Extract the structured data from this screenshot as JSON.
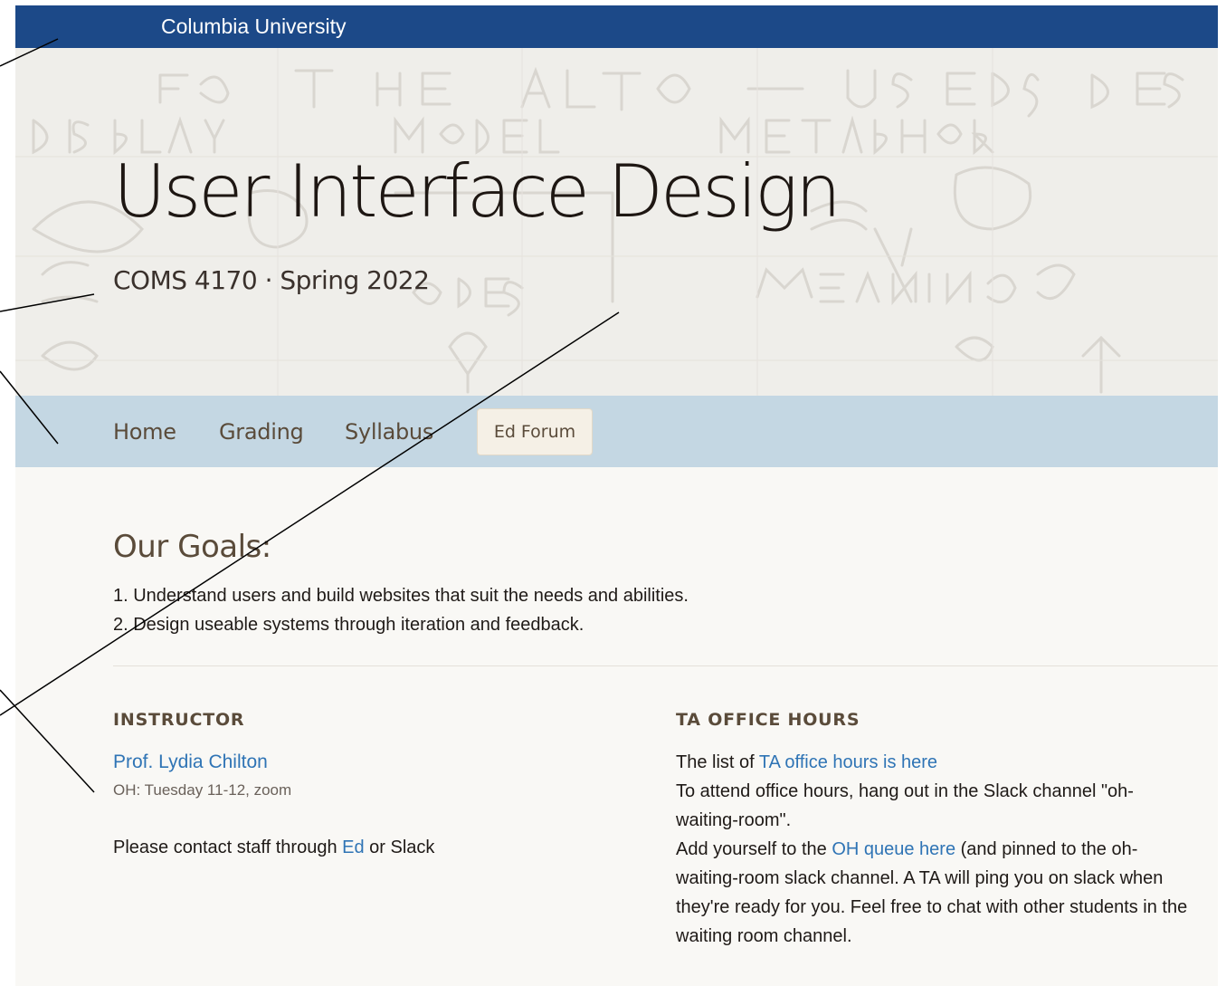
{
  "topbar": {
    "title": "Columbia University"
  },
  "hero": {
    "title": "User Interface Design",
    "subtitle": "COMS 4170 · Spring 2022"
  },
  "nav": {
    "items": [
      {
        "label": "Home"
      },
      {
        "label": "Grading"
      },
      {
        "label": "Syllabus"
      }
    ],
    "button_label": "Ed Forum"
  },
  "goals": {
    "heading": "Our Goals:",
    "items": [
      "1. Understand users and build websites that suit the needs and abilities.",
      "2. Design useable systems through iteration and feedback."
    ]
  },
  "instructor": {
    "heading": "INSTRUCTOR",
    "name": "Prof. Lydia Chilton",
    "office_hours": "OH: Tuesday 11-12, zoom",
    "contact_prefix": "Please contact staff through ",
    "contact_link": "Ed",
    "contact_suffix": " or Slack"
  },
  "ta": {
    "heading": "TA OFFICE HOURS",
    "line1_prefix": "The list of ",
    "line1_link": "TA office hours is here",
    "line2": "To attend office hours, hang out in the Slack channel \"oh-waiting-room\".",
    "line3_prefix": "Add yourself to the ",
    "line3_link": "OH queue here",
    "line3_suffix": " (and pinned to the oh-waiting-room slack channel. A TA will ping you on slack when they're ready for you. Feel free to chat with other students in the waiting room channel."
  },
  "colors": {
    "topbar": "#1c4988",
    "navbar": "#c4d7e3",
    "link": "#2f74b5",
    "heading": "#5a4b3a"
  }
}
